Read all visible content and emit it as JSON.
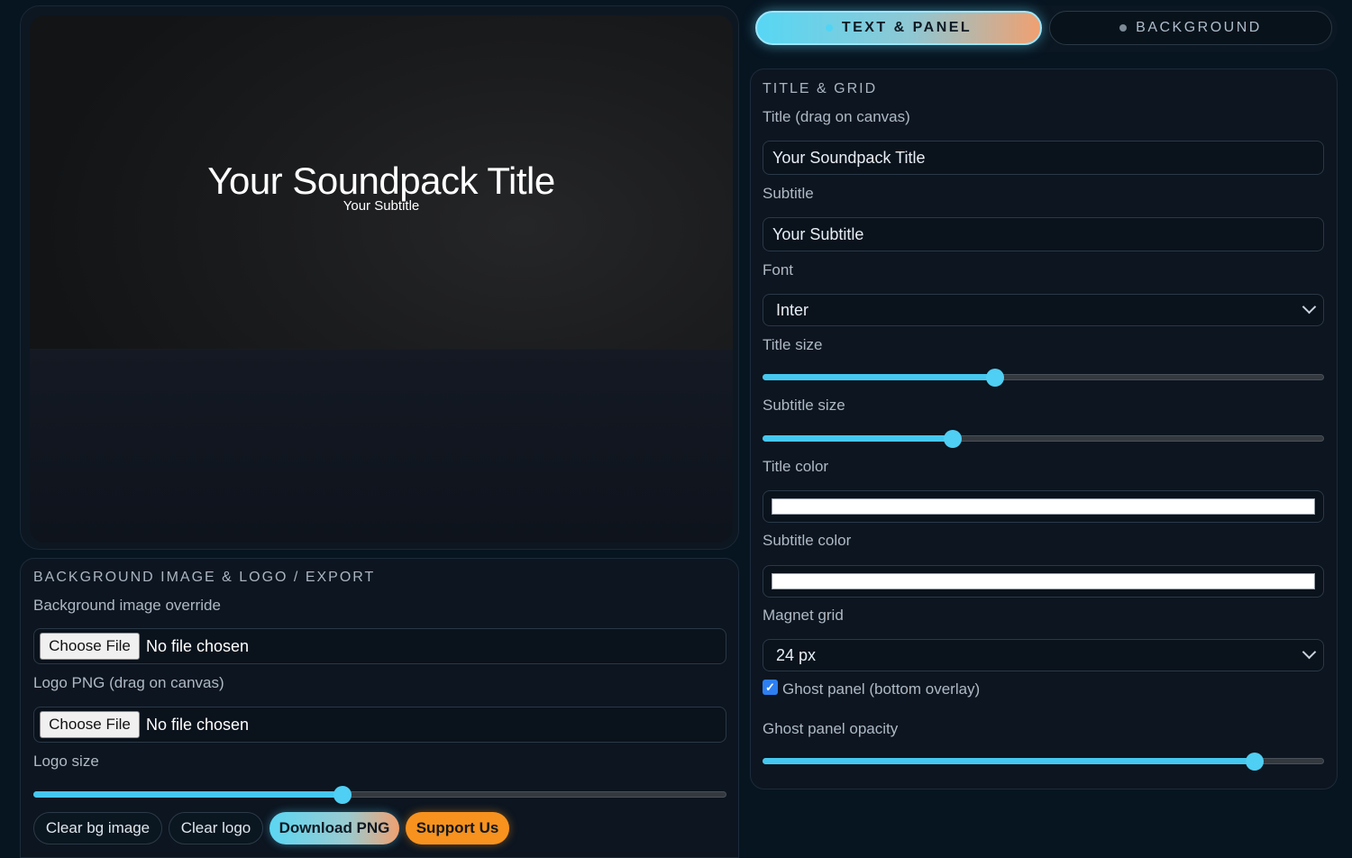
{
  "canvas": {
    "title": "Your Soundpack Title",
    "subtitle": "Your Subtitle"
  },
  "tabs": [
    {
      "label": "TEXT & PANEL",
      "active": true
    },
    {
      "label": "BACKGROUND",
      "active": false
    }
  ],
  "title_grid": {
    "section_title": "TITLE & GRID",
    "title_label": "Title (drag on canvas)",
    "title_value": "Your Soundpack Title",
    "subtitle_label": "Subtitle",
    "subtitle_value": "Your Subtitle",
    "font_label": "Font",
    "font_value": "Inter",
    "title_size_label": "Title size",
    "title_size_fraction": 0.414,
    "subtitle_size_label": "Subtitle size",
    "subtitle_size_fraction": 0.339,
    "title_color_label": "Title color",
    "title_color": "#ffffff",
    "subtitle_color_label": "Subtitle color",
    "subtitle_color": "#ffffff",
    "magnet_grid_label": "Magnet grid",
    "magnet_grid_value": "24 px",
    "ghost_panel_label": "Ghost panel (bottom overlay)",
    "ghost_panel_checked": true,
    "ghost_opacity_label": "Ghost panel opacity",
    "ghost_opacity_fraction": 0.876
  },
  "export": {
    "section_title": "BACKGROUND IMAGE & LOGO / EXPORT",
    "bg_label": "Background image override",
    "choose_file": "Choose File",
    "no_file": "No file chosen",
    "logo_label": "Logo PNG (drag on canvas)",
    "logo_size_label": "Logo size",
    "logo_size_fraction": 0.446,
    "clear_bg": "Clear bg image",
    "clear_logo": "Clear logo",
    "download": "Download PNG",
    "support": "Support Us"
  },
  "colors": {
    "accent": "#4fcff3",
    "support": "#f7921e",
    "background": "#071521"
  }
}
